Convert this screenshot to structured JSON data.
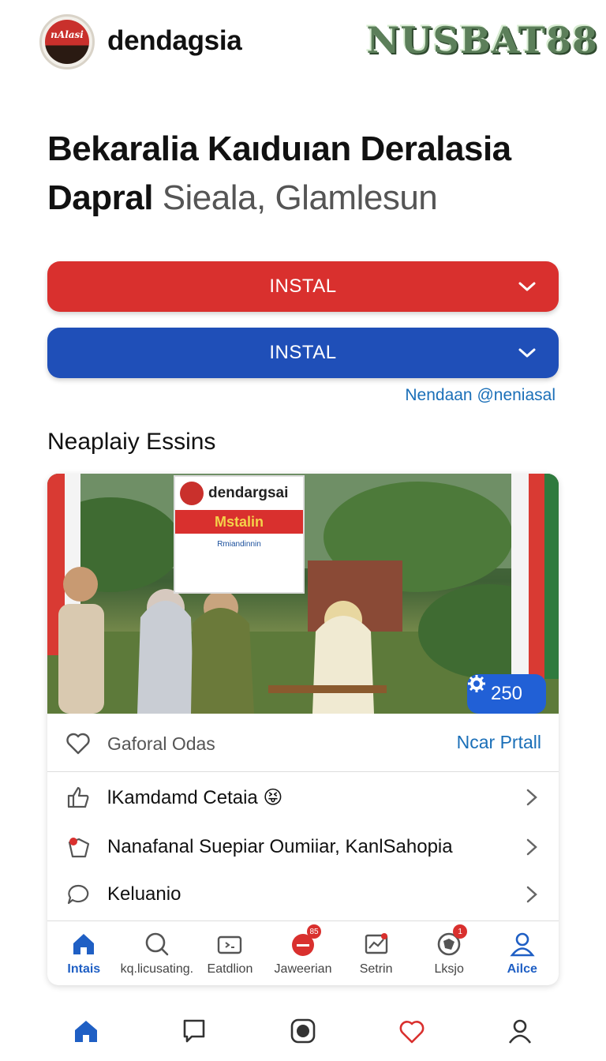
{
  "header": {
    "logo_text": "nAlasi",
    "app_name": "dendagsia",
    "brand_watermark": "NUSBAT88"
  },
  "title": {
    "main": "Bekaralia Kaıduıan Deralasia Dapral",
    "sub": "Sieala, Glamlesun"
  },
  "buttons": {
    "install_red": "INSTAL",
    "install_blue": "INSTAL"
  },
  "link_right": "Nendaan @neniasal",
  "section_title": "Neaplaiy Essins",
  "card": {
    "sign": {
      "name": "dendargsai",
      "band": "Mstalin",
      "foot": "Rmiandinnin"
    },
    "badge_count": "250",
    "like_row": {
      "label": "Gaforal Odas",
      "cta": "Ncar Prtall"
    },
    "list": [
      {
        "label": "lKamdamd Cetaia 😝"
      },
      {
        "label": "Nanafanal Suepiar Oumiiar, KanlSahopia"
      },
      {
        "label": "Keluanio"
      }
    ],
    "tabs": [
      {
        "label": "Intais",
        "icon": "home-icon"
      },
      {
        "label": "kq.licusating.",
        "icon": "search-icon"
      },
      {
        "label": "Eatdlion",
        "icon": "wallet-icon"
      },
      {
        "label": "Jaweerian",
        "icon": "chat-bubble-icon",
        "badge": "85"
      },
      {
        "label": "Setrin",
        "icon": "chart-icon"
      },
      {
        "label": "Lksjo",
        "icon": "gear-icon",
        "badge": "1"
      },
      {
        "label": "Ailce",
        "icon": "person-icon"
      }
    ]
  },
  "bottom_nav": [
    "home-icon",
    "chat-icon",
    "record-icon",
    "shield-icon",
    "profile-icon"
  ],
  "colors": {
    "red": "#d9302e",
    "blue": "#1f4fb8",
    "link": "#1a6fb8",
    "badge": "#2160d6"
  }
}
